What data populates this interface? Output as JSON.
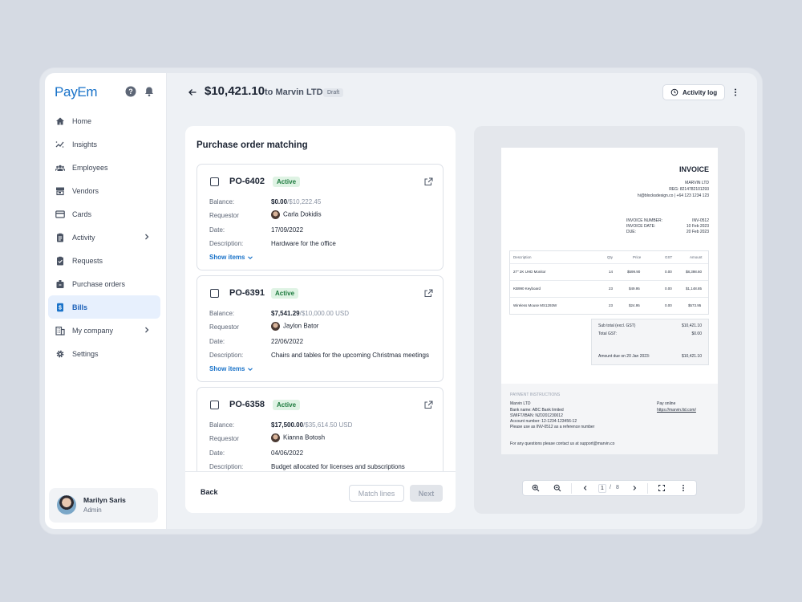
{
  "app": {
    "logo": "PayEm"
  },
  "nav": [
    {
      "label": "Home",
      "icon": "home-icon"
    },
    {
      "label": "Insights",
      "icon": "insights-icon"
    },
    {
      "label": "Employees",
      "icon": "employees-icon"
    },
    {
      "label": "Vendors",
      "icon": "store-icon"
    },
    {
      "label": "Cards",
      "icon": "card-icon"
    },
    {
      "label": "Activity",
      "icon": "clipboard-icon"
    },
    {
      "label": "Requests",
      "icon": "clipboard-check-icon"
    },
    {
      "label": "Purchase orders",
      "icon": "package-icon"
    },
    {
      "label": "Bills",
      "icon": "bill-icon",
      "active": true
    },
    {
      "label": "My company",
      "icon": "building-icon"
    },
    {
      "label": "Settings",
      "icon": "gear-icon"
    }
  ],
  "user": {
    "name": "Marilyn Saris",
    "role": "Admin"
  },
  "header": {
    "amount": "$10,421.10",
    "to_vendor": "to Marvin LTD",
    "status": "Draft",
    "activity_label": "Activity log"
  },
  "matching": {
    "title": "Purchase order matching",
    "labels": {
      "balance": "Balance:",
      "requestor": "Requestor",
      "date": "Date:",
      "description": "Description:",
      "show_items": "Show items"
    },
    "orders": [
      {
        "id": "PO-6402",
        "status": "Active",
        "balance_used": "$0.00",
        "balance_total": "/$10,222.45",
        "requestor": "Carla Dokidis",
        "date": "17/09/2022",
        "description": "Hardware for the office"
      },
      {
        "id": "PO-6391",
        "status": "Active",
        "balance_used": "$7,541.29",
        "balance_total": "/$10,000.00 USD",
        "requestor": "Jaylon Bator",
        "date": "22/06/2022",
        "description": "Chairs and tables for the upcoming Christmas meetings"
      },
      {
        "id": "PO-6358",
        "status": "Active",
        "balance_used": "$17,500.00",
        "balance_total": "/$35,614.50 USD",
        "requestor": "Kianna Botosh",
        "date": "04/06/2022",
        "description": "Budget allocated for licenses and subscriptions"
      }
    ],
    "footer": {
      "back": "Back",
      "match": "Match lines",
      "next": "Next"
    }
  },
  "invoice": {
    "title": "INVOICE",
    "company": "MARVIN LTD",
    "reg": "REG: 8214782101293",
    "contact": "hi@blocksdesign.co | +64 123 1234 123",
    "meta": [
      {
        "k": "INVOICE NUMBER:",
        "v": "INV-0512"
      },
      {
        "k": "INVOICE DATE:",
        "v": "10 Feb 2023"
      },
      {
        "k": "DUE:",
        "v": "20 Feb 2023"
      }
    ],
    "columns": [
      "Description",
      "Qty",
      "Price",
      "GST",
      "Amount"
    ],
    "lines": [
      {
        "desc": "27\" 2K UHD Monitor",
        "qty": "14",
        "price": "$599.90",
        "gst": "0.00",
        "amount": "$8,398.60"
      },
      {
        "desc": "KB990 Keyboard",
        "qty": "23",
        "price": "$49.95",
        "gst": "0.00",
        "amount": "$1,148.85"
      },
      {
        "desc": "Wireless Mouse MS1293W",
        "qty": "23",
        "price": "$24.95",
        "gst": "0.00",
        "amount": "$573.95"
      }
    ],
    "totals": {
      "subtotal_label": "Sub total (excl. GST)",
      "subtotal": "$10,421.10",
      "gst_label": "Total GST:",
      "gst": "$0.00",
      "due_label": "Amount due on 20 Jan 2023:",
      "due": "$10,421.10"
    },
    "payment": {
      "heading": "PAYMENT INSTRUCTIONS",
      "line1": "Marvin LTD",
      "line2": "Bank name: ABC Bank limited",
      "line3": "SWIFT/IBAN: NZ0201230012",
      "line4": "Account number: 12-1234-123456-12",
      "line5": "Please use as INV-0512 as a reference number",
      "pay_online": "Pay online",
      "link": "https://marvin.ltd.com/",
      "questions": "For any questions please contact us at support@marvin.co"
    }
  },
  "viewer": {
    "page": "1",
    "separator": "/",
    "total": "8"
  }
}
